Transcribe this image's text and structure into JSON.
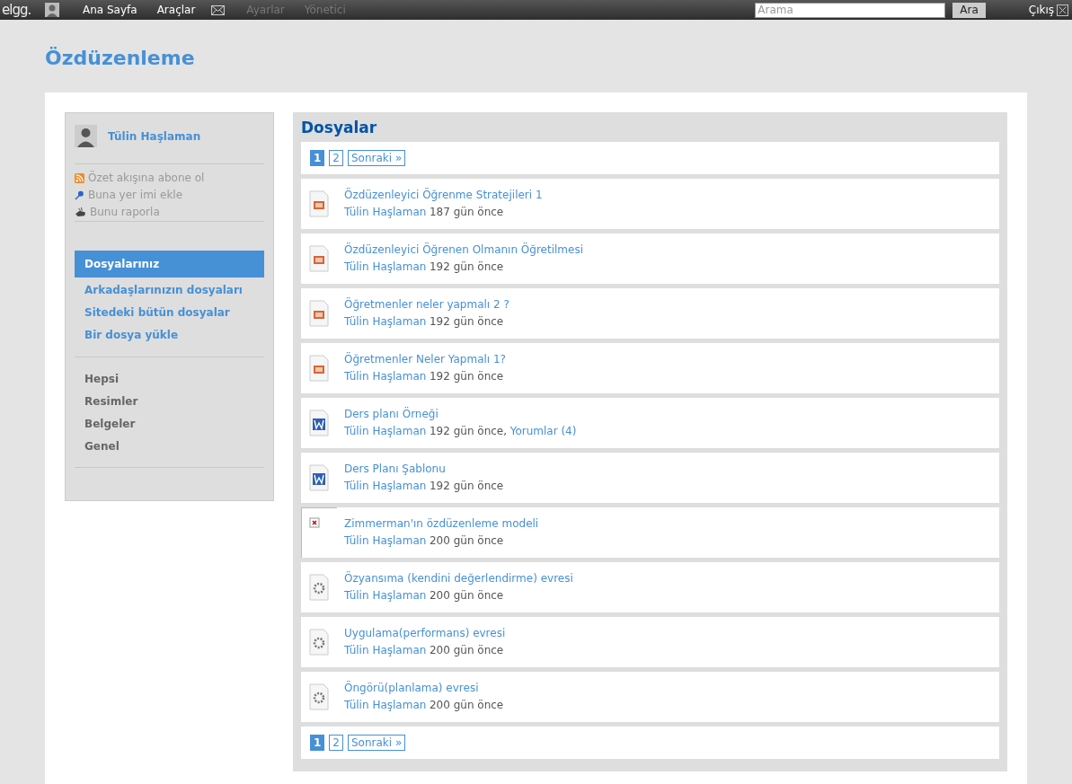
{
  "topbar": {
    "logo": "elgg.",
    "nav": [
      {
        "label": "Ana Sayfa",
        "disabled": false
      },
      {
        "label": "Araçlar",
        "disabled": false
      },
      {
        "label": "Ayarlar",
        "disabled": true
      },
      {
        "label": "Yönetici",
        "disabled": true
      }
    ],
    "search": {
      "placeholder": "Arama",
      "button": "Ara"
    },
    "logout": "Çıkış"
  },
  "page_title": "Özdüzenleme",
  "sidebar": {
    "user": "Tülin Haşlaman",
    "actions": [
      {
        "kind": "rss",
        "label": "Özet akışına abone ol"
      },
      {
        "kind": "pin",
        "label": "Buna yer imi ekle"
      },
      {
        "kind": "report",
        "label": "Bunu raporla"
      }
    ],
    "menu": [
      {
        "label": "Dosyalarınız",
        "selected": true
      },
      {
        "label": "Arkadaşlarınızın dosyaları",
        "selected": false
      },
      {
        "label": "Sitedeki bütün dosyalar",
        "selected": false
      },
      {
        "label": "Bir dosya yükle",
        "selected": false
      }
    ],
    "filters": [
      "Hepsi",
      "Resimler",
      "Belgeler",
      "Genel"
    ]
  },
  "main": {
    "title": "Dosyalar",
    "pagination_top": {
      "pages": [
        {
          "label": "1",
          "selected": true
        },
        {
          "label": "2",
          "selected": false
        }
      ],
      "next": "Sonraki »"
    },
    "files": [
      {
        "kind": "ppt",
        "title": "Özdüzenleyici Öğrenme Stratejileri 1",
        "author": "Tülin Haşlaman",
        "time": "187 gün önce"
      },
      {
        "kind": "ppt",
        "title": "Özdüzenleyici Öğrenen Olmanın Öğretilmesi",
        "author": "Tülin Haşlaman",
        "time": "192 gün önce"
      },
      {
        "kind": "ppt",
        "title": "Öğretmenler neler yapmalı 2 ?",
        "author": "Tülin Haşlaman",
        "time": "192 gün önce"
      },
      {
        "kind": "ppt",
        "title": "Öğretmenler Neler Yapmalı 1?",
        "author": "Tülin Haşlaman",
        "time": "192 gün önce"
      },
      {
        "kind": "word",
        "title": "Ders planı Örneği",
        "author": "Tülin Haşlaman",
        "time": "192 gün önce,",
        "comments": "Yorumlar (4)"
      },
      {
        "kind": "word",
        "title": "Ders Planı Şablonu",
        "author": "Tülin Haşlaman",
        "time": "192 gün önce"
      },
      {
        "kind": "broken",
        "title": "Zimmerman'ın özdüzenleme modeli",
        "author": "Tülin Haşlaman",
        "time": "200 gün önce"
      },
      {
        "kind": "generic",
        "title": "Özyansıma (kendini değerlendirme) evresi",
        "author": "Tülin Haşlaman",
        "time": "200 gün önce"
      },
      {
        "kind": "generic",
        "title": "Uygulama(performans) evresi",
        "author": "Tülin Haşlaman",
        "time": "200 gün önce"
      },
      {
        "kind": "generic",
        "title": "Öngörü(planlama) evresi",
        "author": "Tülin Haşlaman",
        "time": "200 gün önce"
      }
    ],
    "pagination_bottom": {
      "pages": [
        {
          "label": "1",
          "selected": true
        },
        {
          "label": "2",
          "selected": false
        }
      ],
      "next": "Sonraki »"
    }
  }
}
